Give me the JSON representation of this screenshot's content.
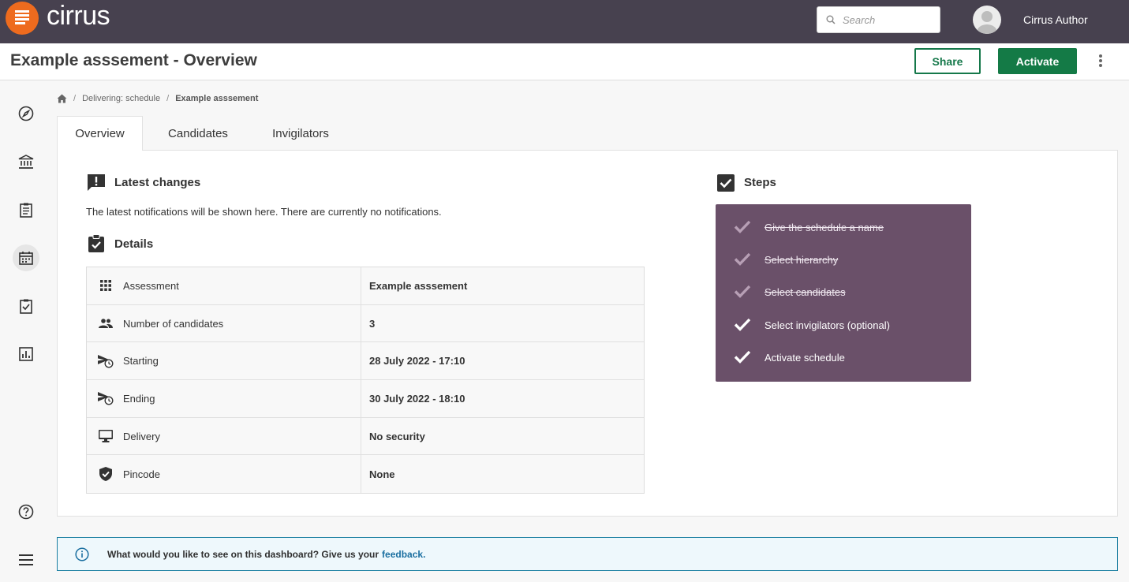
{
  "app": {
    "logo_text": "cirrus"
  },
  "search": {
    "placeholder": "Search"
  },
  "user": {
    "name": "Cirrus Author"
  },
  "page": {
    "title": "Example asssement - Overview"
  },
  "actions": {
    "share_label": "Share",
    "activate_label": "Activate"
  },
  "breadcrumb": {
    "items": [
      "Delivering: schedule",
      "Example asssement"
    ]
  },
  "tabs": [
    {
      "label": "Overview",
      "active": true
    },
    {
      "label": "Candidates",
      "active": false
    },
    {
      "label": "Invigilators",
      "active": false
    }
  ],
  "latest_changes": {
    "title": "Latest changes",
    "message": "The latest notifications will be shown here. There are currently no notifications."
  },
  "details": {
    "title": "Details",
    "rows": [
      {
        "icon": "grid-icon",
        "label": "Assessment",
        "value": "Example asssement"
      },
      {
        "icon": "people-icon",
        "label": "Number of candidates",
        "value": "3"
      },
      {
        "icon": "schedule-send-icon",
        "label": "Starting",
        "value": "28 July 2022 - 17:10"
      },
      {
        "icon": "schedule-send-icon",
        "label": "Ending",
        "value": "30 July 2022 - 18:10"
      },
      {
        "icon": "monitor-icon",
        "label": "Delivery",
        "value": "No security"
      },
      {
        "icon": "shield-check-icon",
        "label": "Pincode",
        "value": "None"
      }
    ]
  },
  "steps": {
    "title": "Steps",
    "items": [
      {
        "label": "Give the schedule a name",
        "done": true
      },
      {
        "label": "Select hierarchy",
        "done": true
      },
      {
        "label": "Select candidates",
        "done": true
      },
      {
        "label": "Select invigilators (optional)",
        "done": false
      },
      {
        "label": "Activate schedule",
        "done": false
      }
    ]
  },
  "feedback": {
    "message": "What would you like to see on this dashboard? Give us your",
    "link_label": "feedback."
  },
  "colors": {
    "topbar": "#47414f",
    "brand": "#ee6b1e",
    "primary_green": "#147a46",
    "steps_bg": "#6a5069",
    "banner_border": "#1a7ea0"
  }
}
